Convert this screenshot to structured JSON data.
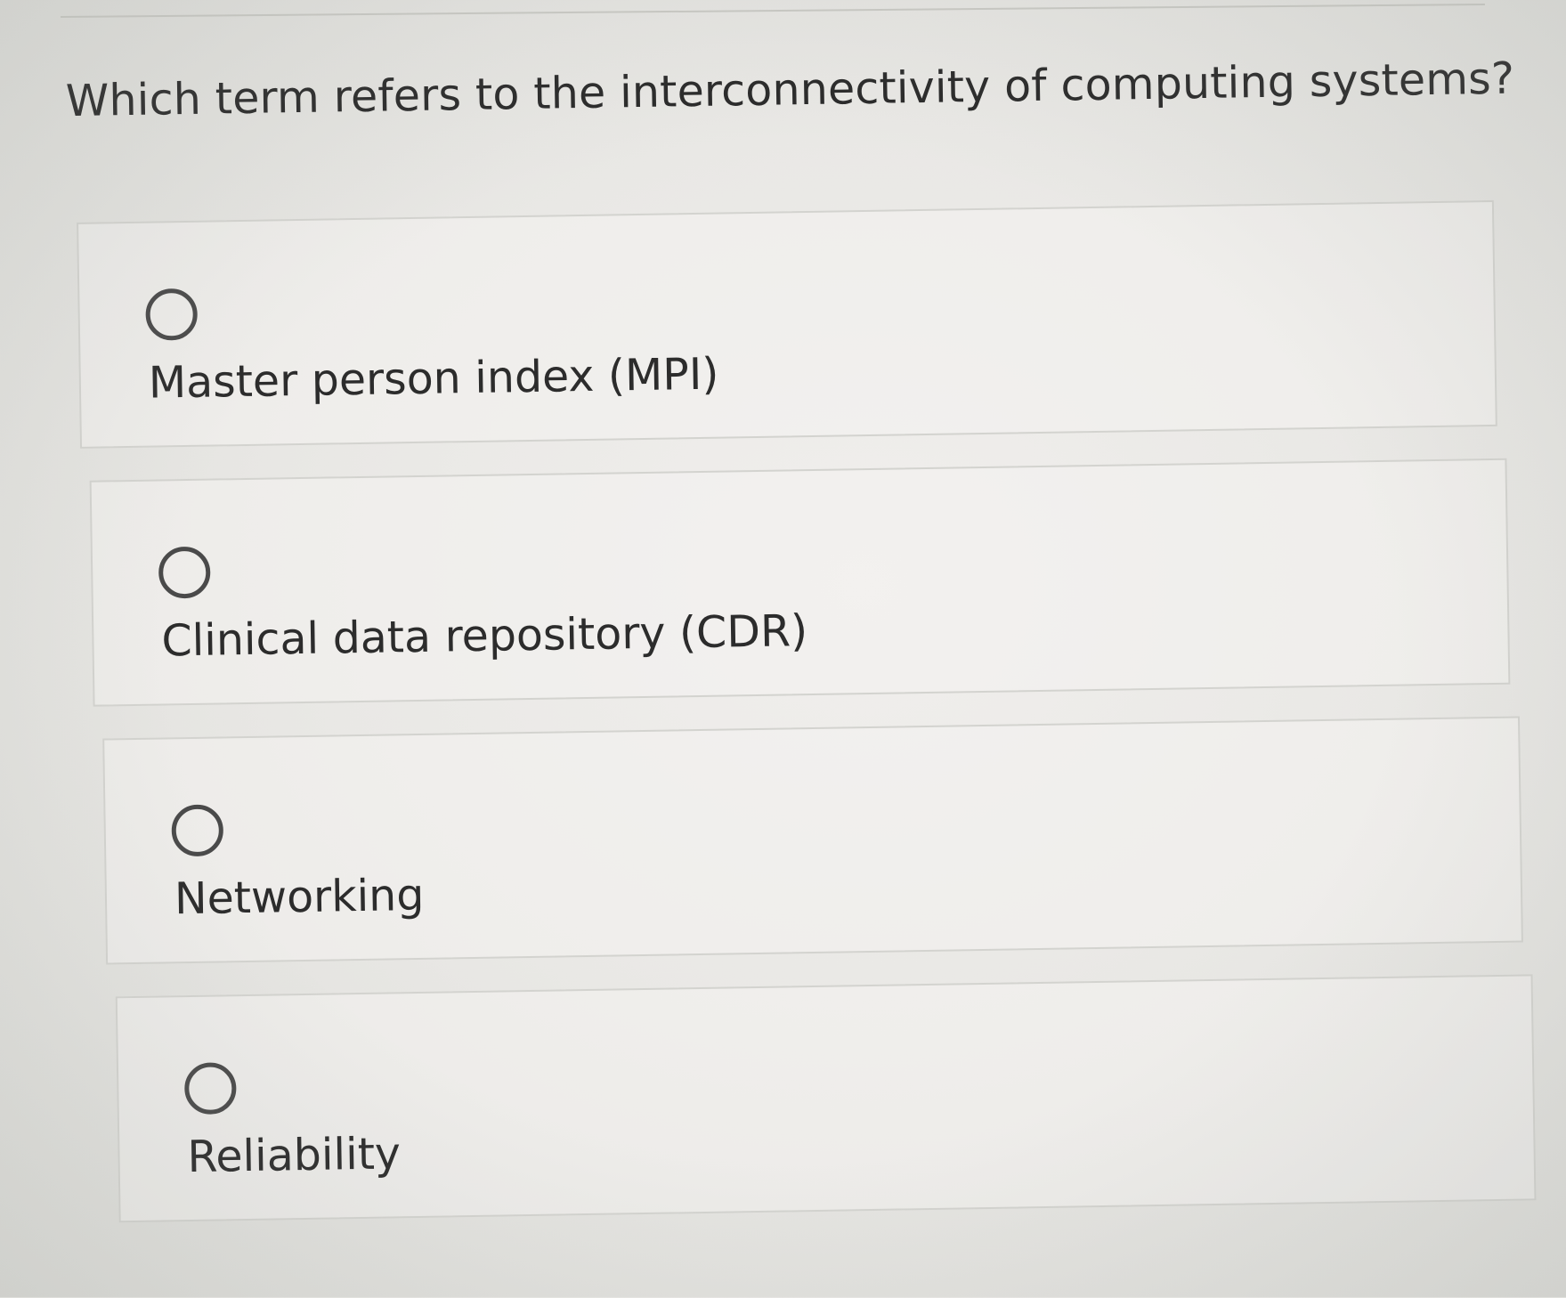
{
  "question": {
    "text": "Which term refers to the interconnectivity of computing systems?"
  },
  "options": [
    {
      "label": "Master person index (MPI)",
      "selected": false
    },
    {
      "label": "Clinical data repository (CDR)",
      "selected": false
    },
    {
      "label": "Networking",
      "selected": false
    },
    {
      "label": "Reliability",
      "selected": false
    }
  ],
  "colors": {
    "text": "#2c2c2c",
    "border": "#d3d3cf",
    "radio": "#4a4a4a"
  },
  "icons": {
    "radio": "radio-unchecked-icon"
  }
}
